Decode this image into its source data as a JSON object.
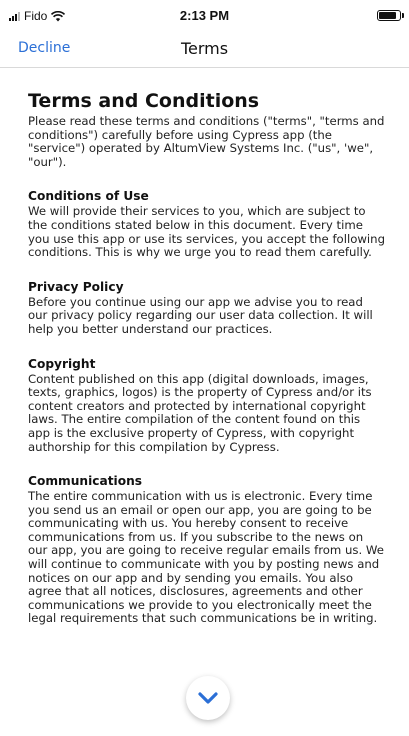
{
  "status_bar": {
    "carrier": "Fido",
    "time": "2:13 PM",
    "battery_level": 0.9
  },
  "nav": {
    "decline_label": "Decline",
    "title": "Terms"
  },
  "document": {
    "title": "Terms and Conditions",
    "intro": "Please read these terms and conditions (\"terms\", \"terms and conditions\") carefully before using Cypress app (the \"service\") operated by AltumView Systems Inc. (\"us\", 'we\", \"our\").",
    "sections": [
      {
        "heading": "Conditions of Use",
        "body": "We will provide their services to you, which are subject to the conditions stated below in this document. Every time you use this app or use its services, you accept the following conditions. This is why we urge you to read them carefully."
      },
      {
        "heading": "Privacy Policy",
        "body": "Before you continue using our app we advise you to read our privacy policy regarding our user data collection. It will help you better understand our practices."
      },
      {
        "heading": "Copyright",
        "body": "Content published on this app (digital downloads, images, texts, graphics, logos) is the property of Cypress and/or its content creators and protected by international copyright laws. The entire compilation of the content found on this app is the exclusive property of Cypress, with copyright authorship for this compilation by Cypress."
      },
      {
        "heading": "Communications",
        "body": "The entire communication with us is electronic. Every time you send us an email or open our app, you are going to be communicating with us. You hereby consent to receive communications from us. If you subscribe to the news on our app, you are going to receive regular emails from us. We will continue to communicate with you by posting news and notices on our app and by sending you emails. You also agree that all notices, disclosures, agreements and other communications we provide to you electronically meet the legal requirements that such communications be in writing."
      }
    ]
  },
  "icons": {
    "scroll": "chevron-down-icon",
    "signal": "signal-icon",
    "wifi": "wifi-icon",
    "battery": "battery-icon"
  },
  "colors": {
    "accent": "#2b6fd6"
  }
}
